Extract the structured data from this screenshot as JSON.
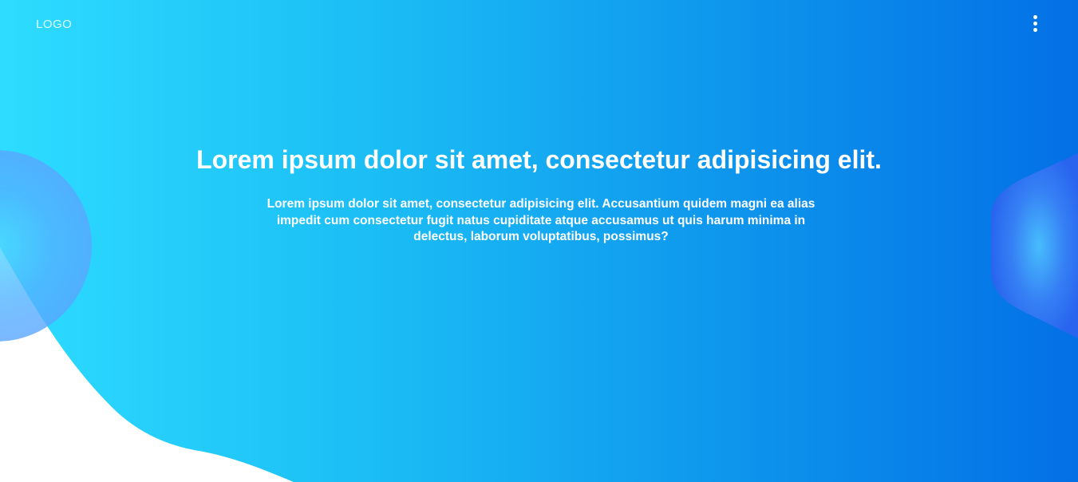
{
  "header": {
    "logo_text": "LOGO",
    "menu_icon": "vertical-ellipsis-icon"
  },
  "hero": {
    "title": "Lorem ipsum dolor sit amet, consectetur adipisicing elit.",
    "description": "Lorem ipsum dolor sit amet, consectetur adipisicing elit. Accusantium quidem magni ea alias impedit cum consectetur fugit natus cupiditate atque accusamus ut quis harum minima in delectus, laborum voluptatibus, possimus?"
  },
  "colors": {
    "gradient_start": "#2ddcff",
    "gradient_end": "#0370e6",
    "text": "#ffffff",
    "wave": "#ffffff"
  }
}
